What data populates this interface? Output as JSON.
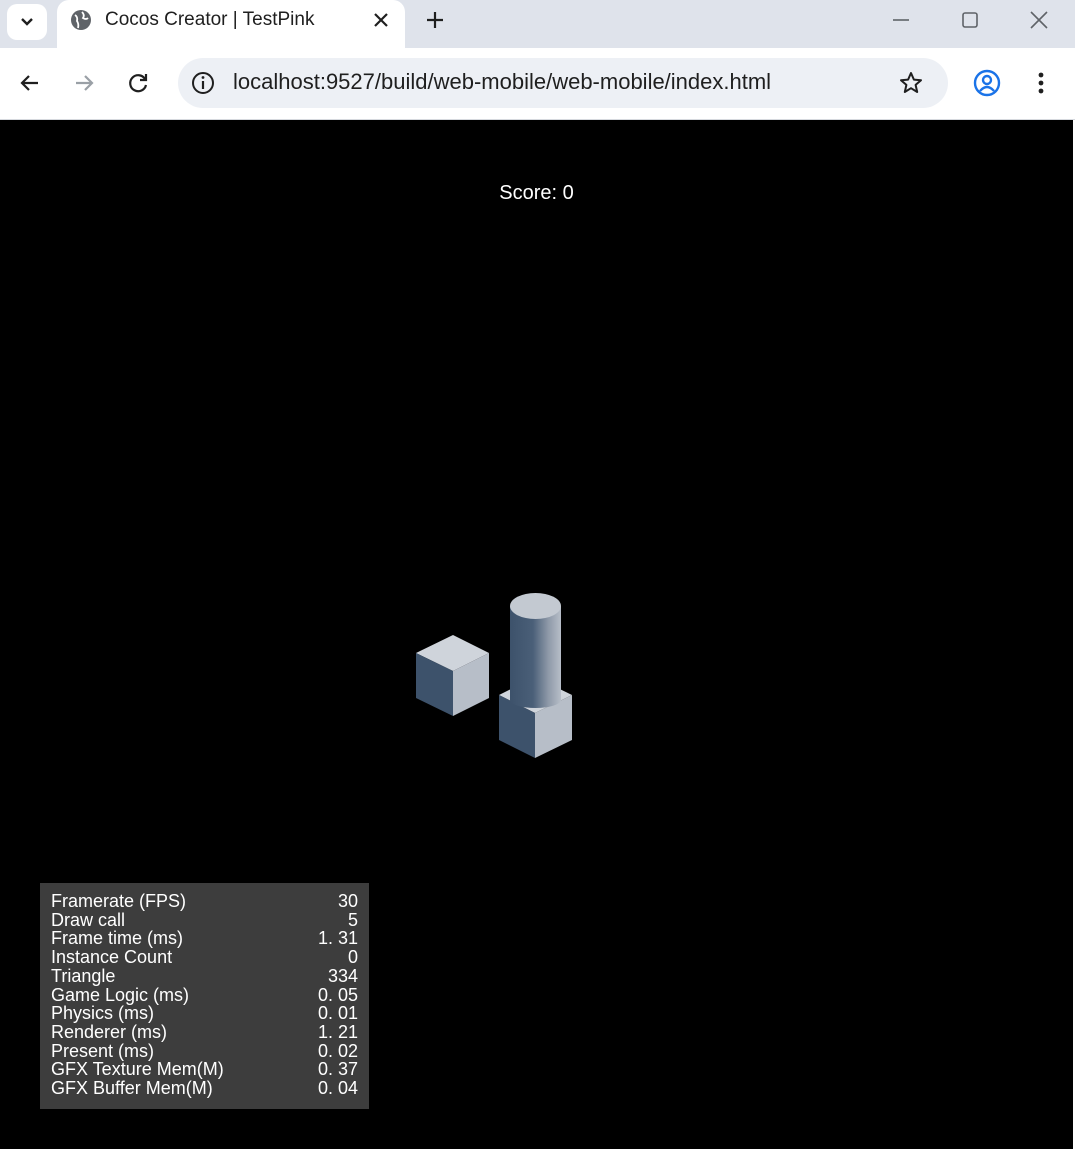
{
  "browser": {
    "tab_title": "Cocos Creator | TestPink",
    "url": "localhost:9527/build/web-mobile/web-mobile/index.html",
    "icons": {
      "tab_search": "chevron-down-icon",
      "favicon": "globe-icon",
      "tab_close": "close-icon",
      "new_tab": "plus-icon",
      "minimize": "minimize-icon",
      "maximize": "maximize-icon",
      "close_window": "close-icon",
      "back": "arrow-left-icon",
      "forward": "arrow-right-icon",
      "reload": "reload-icon",
      "site_info": "info-icon",
      "bookmark": "star-icon",
      "profile": "profile-icon",
      "menu": "kebab-menu-icon"
    }
  },
  "game": {
    "score_text": "Score: 0",
    "colors": {
      "background": "#000000",
      "object_light": "#b7bec8",
      "object_dark": "#3d526b"
    }
  },
  "stats": {
    "rows": [
      {
        "label": "Framerate (FPS)",
        "value": "30"
      },
      {
        "label": "Draw call",
        "value": "5"
      },
      {
        "label": "Frame time (ms)",
        "value": "1. 31"
      },
      {
        "label": "Instance Count",
        "value": "0"
      },
      {
        "label": "Triangle",
        "value": "334"
      },
      {
        "label": "Game Logic (ms)",
        "value": "0. 05"
      },
      {
        "label": "Physics (ms)",
        "value": "0. 01"
      },
      {
        "label": "Renderer (ms)",
        "value": "1. 21"
      },
      {
        "label": "Present (ms)",
        "value": "0. 02"
      },
      {
        "label": "GFX Texture Mem(M)",
        "value": "0. 37"
      },
      {
        "label": "GFX Buffer Mem(M)",
        "value": "0. 04"
      }
    ]
  }
}
